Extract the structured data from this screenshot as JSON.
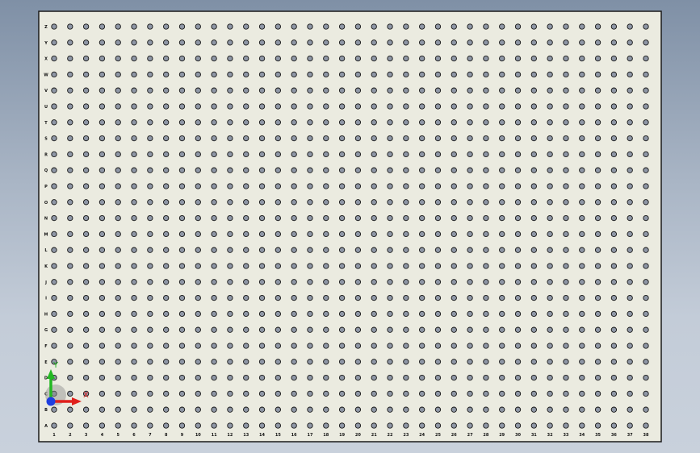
{
  "window": {
    "title": ""
  },
  "board": {
    "fill_color": "#ebebe0",
    "border_color": "#1a1a1a",
    "hole_color": "#8f97a6",
    "hole_stroke": "#151515",
    "column_labels": [
      "1",
      "2",
      "3",
      "4",
      "5",
      "6",
      "7",
      "8",
      "9",
      "10",
      "11",
      "12",
      "13",
      "14",
      "15",
      "16",
      "17",
      "18",
      "19",
      "20",
      "21",
      "22",
      "23",
      "24",
      "25",
      "26",
      "27",
      "28",
      "29",
      "30",
      "31",
      "32",
      "33",
      "34",
      "35",
      "36",
      "37",
      "38"
    ],
    "row_labels": [
      "Z",
      "Y",
      "X",
      "W",
      "V",
      "U",
      "T",
      "S",
      "R",
      "Q",
      "P",
      "O",
      "N",
      "M",
      "L",
      "K",
      "J",
      "I",
      "H",
      "G",
      "F",
      "E",
      "D",
      "C",
      "B",
      "A"
    ]
  },
  "triad": {
    "x_label": "X",
    "y_label": "Y",
    "x_color": "#e0201c",
    "y_color": "#22b822",
    "z_color": "#1f3fe0"
  }
}
